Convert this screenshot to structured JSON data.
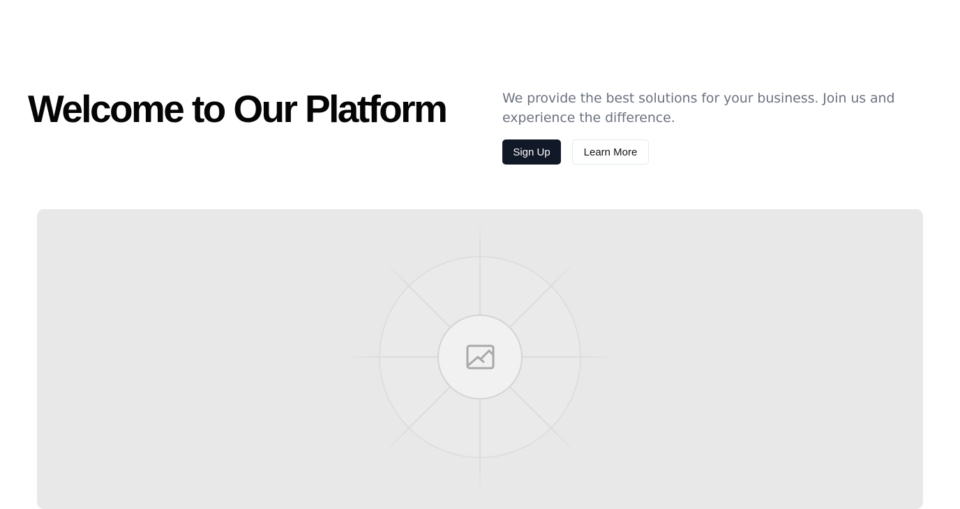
{
  "hero": {
    "title": "Welcome to Our Platform",
    "description": "We provide the best solutions for your business. Join us and experience the difference.",
    "primary_button": "Sign Up",
    "secondary_button": "Learn More"
  },
  "image_placeholder": {
    "icon": "image-icon",
    "background_color": "#e8e8e8"
  },
  "colors": {
    "primary_button_bg": "#111827",
    "description_text": "#6b7280",
    "title_text": "#050505"
  }
}
